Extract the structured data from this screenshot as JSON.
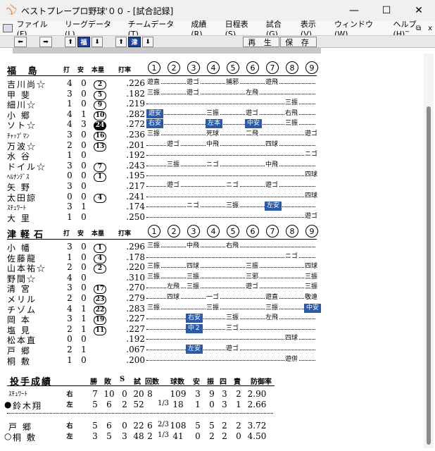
{
  "window": {
    "title": "ベストプレープロ野球'００ - [試合記録]",
    "minimize": "—",
    "maximize": "☐",
    "close": "✕"
  },
  "menu": [
    "ファイル(F)",
    "リーグデータ(L)",
    "チームデータ(T)",
    "成績(R)",
    "日程表(S)",
    "試合(G)",
    "表示(V)",
    "ウィンドウ(W)",
    "ヘルプ(H)"
  ],
  "mdi": {
    "min": "_",
    "restore": "⧉",
    "close": "x"
  },
  "toolbar": {
    "team1": "福",
    "team2": "津",
    "play": "再 生",
    "save": "保 存"
  },
  "innings_header": [
    "1",
    "2",
    "3",
    "4",
    "5",
    "6",
    "7",
    "8",
    "9"
  ],
  "cols": {
    "ab": "打",
    "h": "安",
    "hr": "本塁",
    "avg": "打率"
  },
  "team1": {
    "name": "福 島",
    "players": [
      {
        "name": "吉川尚☆",
        "ab": "4",
        "h": "0",
        "hr": "2",
        "hrfill": false,
        "avg": ".226",
        "res": [
          [
            "1",
            "遊直",
            false
          ],
          [
            "3",
            "遊ゴ",
            false
          ],
          [
            "5",
            "捕邪",
            false
          ],
          [
            "7",
            "遊飛",
            false
          ]
        ]
      },
      {
        "name": "甲 斐",
        "ab": "3",
        "h": "0",
        "hr": "5",
        "hrfill": false,
        "avg": ".182",
        "res": [
          [
            "1",
            "三振",
            false
          ],
          [
            "3",
            "遊ゴ",
            false
          ],
          [
            "6",
            "左飛",
            false
          ]
        ]
      },
      {
        "name": "細川☆",
        "ab": "1",
        "h": "0",
        "hr": "9",
        "hrfill": false,
        "avg": ".219",
        "res": [
          [
            "8",
            "三振",
            false
          ]
        ]
      },
      {
        "name": "小 郷",
        "ab": "4",
        "h": "1",
        "hr": "10",
        "hrfill": false,
        "avg": ".282",
        "res": [
          [
            "1",
            "遊安",
            true
          ],
          [
            "4",
            "三振",
            false
          ],
          [
            "6",
            "遊ゴ",
            false
          ],
          [
            "8",
            "右飛",
            false
          ]
        ]
      },
      {
        "name": "ソト☆",
        "ab": "4",
        "h": "3",
        "hr": "24",
        "hrfill": true,
        "avg": ".272",
        "res": [
          [
            "1",
            "右安",
            true
          ],
          [
            "4",
            "左本",
            true
          ],
          [
            "6",
            "中安",
            true
          ],
          [
            "8",
            "三振",
            false
          ]
        ]
      },
      {
        "name": "ﾁｬｯﾌﾟﾏﾝ",
        "sm": true,
        "ab": "3",
        "h": "0",
        "hr": "16",
        "hrfill": false,
        "avg": ".236",
        "res": [
          [
            "1",
            "三振",
            false
          ],
          [
            "4",
            "死球",
            false
          ],
          [
            "6",
            "二飛",
            false
          ],
          [
            "9",
            "遊ゴ",
            false
          ]
        ]
      },
      {
        "name": "万波☆",
        "ab": "2",
        "h": "0",
        "hr": "13",
        "hrfill": false,
        "avg": ".201",
        "res": [
          [
            "2",
            "遊ゴ",
            false
          ],
          [
            "4",
            "中飛",
            false
          ],
          [
            "7",
            "四球",
            false
          ]
        ]
      },
      {
        "name": "水 谷",
        "ab": "1",
        "h": "0",
        "hr": "",
        "hrfill": false,
        "avg": ".192",
        "res": [
          [
            "9",
            "ニゴ",
            false
          ]
        ]
      },
      {
        "name": "ドイル☆",
        "ab": "3",
        "h": "0",
        "hr": "7",
        "hrfill": false,
        "avg": ".243",
        "res": [
          [
            "2",
            "三振",
            false
          ],
          [
            "4",
            "ニゴ",
            false
          ],
          [
            "7",
            "中飛",
            false
          ]
        ]
      },
      {
        "name": "ﾍﾙﾅﾝﾃﾞｽ",
        "sm": true,
        "ab": "0",
        "h": "0",
        "hr": "1",
        "hrfill": false,
        "avg": ".195",
        "res": [
          [
            "9",
            "四球",
            false
          ]
        ]
      },
      {
        "name": "矢 野",
        "ab": "3",
        "h": "0",
        "hr": "",
        "hrfill": false,
        "avg": ".217",
        "res": [
          [
            "2",
            "遊ゴ",
            false
          ],
          [
            "5",
            "ニゴ",
            false
          ],
          [
            "7",
            "遊ゴ",
            false
          ]
        ]
      },
      {
        "name": "太田諒",
        "ab": "0",
        "h": "0",
        "hr": "4",
        "hrfill": false,
        "avg": ".241",
        "res": [
          [
            "9",
            "四球",
            false
          ]
        ]
      },
      {
        "name": "ｽﾁｭﾜｰﾄ",
        "sm": true,
        "ab": "3",
        "h": "1",
        "hr": "",
        "hrfill": false,
        "avg": ".174",
        "res": [
          [
            "3",
            "ニゴ",
            false
          ],
          [
            "5",
            "三振",
            false
          ],
          [
            "7",
            "左安",
            true
          ]
        ]
      },
      {
        "name": "大 里",
        "ab": "1",
        "h": "0",
        "hr": "",
        "hrfill": false,
        "avg": ".250",
        "res": [
          [
            "9",
            "遊ゴ",
            false
          ]
        ]
      }
    ]
  },
  "team2": {
    "name": "津軽石",
    "players": [
      {
        "name": "小 幡",
        "ab": "3",
        "h": "0",
        "hr": "1",
        "hrfill": false,
        "avg": ".296",
        "res": [
          [
            "1",
            "三振",
            false
          ],
          [
            "3",
            "中飛",
            false
          ],
          [
            "5",
            "右飛",
            false
          ]
        ]
      },
      {
        "name": "佐藤龍",
        "ab": "1",
        "h": "0",
        "hr": "4",
        "hrfill": false,
        "avg": ".178",
        "res": [
          [
            "8",
            "ニゴ",
            false
          ]
        ]
      },
      {
        "name": "山本祐☆",
        "ab": "2",
        "h": "0",
        "hr": "2",
        "hrfill": false,
        "avg": ".220",
        "res": [
          [
            "1",
            "三振",
            false
          ],
          [
            "3",
            "四球",
            false
          ],
          [
            "6",
            "三振",
            false
          ],
          [
            "9",
            "四球",
            false
          ]
        ]
      },
      {
        "name": "野間☆",
        "ab": "4",
        "h": "0",
        "hr": "",
        "hrfill": false,
        "avg": ".310",
        "res": [
          [
            "1",
            "三振",
            false
          ],
          [
            "3",
            "三振",
            false
          ],
          [
            "6",
            "三邪",
            false
          ],
          [
            "9",
            "三振",
            false
          ]
        ]
      },
      {
        "name": "清 宮",
        "ab": "3",
        "h": "0",
        "hr": "17",
        "hrfill": false,
        "avg": ".270",
        "res": [
          [
            "2",
            "左飛",
            false
          ],
          [
            "3",
            "三振",
            false
          ],
          [
            "6",
            "遊ゴ",
            false
          ],
          [
            "9",
            "三振",
            false
          ]
        ]
      },
      {
        "name": "メリル",
        "ab": "2",
        "h": "0",
        "hr": "23",
        "hrfill": false,
        "avg": ".279",
        "res": [
          [
            "2",
            "四球",
            false
          ],
          [
            "4",
            "一ゴ",
            false
          ],
          [
            "7",
            "遊直",
            false
          ],
          [
            "9",
            "敬遠",
            false
          ]
        ]
      },
      {
        "name": "チゾム",
        "ab": "4",
        "h": "1",
        "hr": "22",
        "hrfill": false,
        "avg": ".283",
        "res": [
          [
            "1",
            "三振",
            false
          ],
          [
            "4",
            "三振",
            false
          ],
          [
            "7",
            "三振",
            false
          ],
          [
            "9",
            "中安",
            true
          ]
        ]
      },
      {
        "name": "岡 本",
        "ab": "3",
        "h": "1",
        "hr": "19",
        "hrfill": false,
        "avg": ".227",
        "res": [
          [
            "3",
            "右安",
            true
          ],
          [
            "5",
            "三振",
            false
          ],
          [
            "7",
            "左飛",
            false
          ]
        ]
      },
      {
        "name": "塩 見",
        "ab": "2",
        "h": "1",
        "hr": "11",
        "hrfill": false,
        "avg": ".227",
        "res": [
          [
            "3",
            "中２",
            true
          ],
          [
            "5",
            "三ゴ",
            false
          ]
        ]
      },
      {
        "name": "松本直",
        "ab": "0",
        "h": "0",
        "hr": "",
        "hrfill": false,
        "avg": ".192",
        "res": [
          [
            "8",
            "四球",
            false
          ]
        ]
      },
      {
        "name": "戸 郷",
        "ab": "2",
        "h": "1",
        "hr": "",
        "hrfill": false,
        "avg": ".067",
        "res": [
          [
            "3",
            "左安",
            true
          ],
          [
            "5",
            "遊ゴ",
            false
          ]
        ]
      },
      {
        "name": "桐 敷",
        "ab": "1",
        "h": "0",
        "hr": "",
        "hrfill": false,
        "avg": ".200",
        "res": [
          [
            "8",
            "遊併",
            false
          ]
        ]
      }
    ]
  },
  "pitching": {
    "title": "投手成績",
    "headers": [
      "勝",
      "敗",
      "S",
      "試",
      "回数",
      "球数",
      "安",
      "振",
      "四",
      "責",
      "防御率"
    ],
    "team1": [
      {
        "mark": "",
        "name": "ｽﾁｭﾜｰﾄ",
        "sm": true,
        "hand": "右",
        "w": "7",
        "l": "10",
        "s": "0",
        "g": "20",
        "ip": "8",
        "ipf": "",
        "np": "109",
        "h": "3",
        "k": "9",
        "bb": "3",
        "er": "2",
        "era": "2.90"
      },
      {
        "mark": "●",
        "name": "鈴木翔",
        "sm": false,
        "hand": "左",
        "w": "5",
        "l": "6",
        "s": "2",
        "g": "52",
        "ip": "",
        "ipf": "1/3",
        "np": "18",
        "h": "1",
        "k": "0",
        "bb": "3",
        "er": "1",
        "era": "2.66"
      }
    ],
    "team2": [
      {
        "mark": "",
        "name": "戸 郷",
        "sm": false,
        "hand": "右",
        "w": "5",
        "l": "6",
        "s": "0",
        "g": "22",
        "ip": "6",
        "ipf": "2/3",
        "np": "108",
        "h": "5",
        "k": "5",
        "bb": "2",
        "er": "2",
        "era": "3.72"
      },
      {
        "mark": "○",
        "name": "桐 敷",
        "sm": false,
        "hand": "左",
        "w": "3",
        "l": "5",
        "s": "3",
        "g": "48",
        "ip": "2",
        "ipf": "1/3",
        "np": "41",
        "h": "0",
        "k": "2",
        "bb": "2",
        "er": "0",
        "era": "4.50"
      }
    ]
  }
}
